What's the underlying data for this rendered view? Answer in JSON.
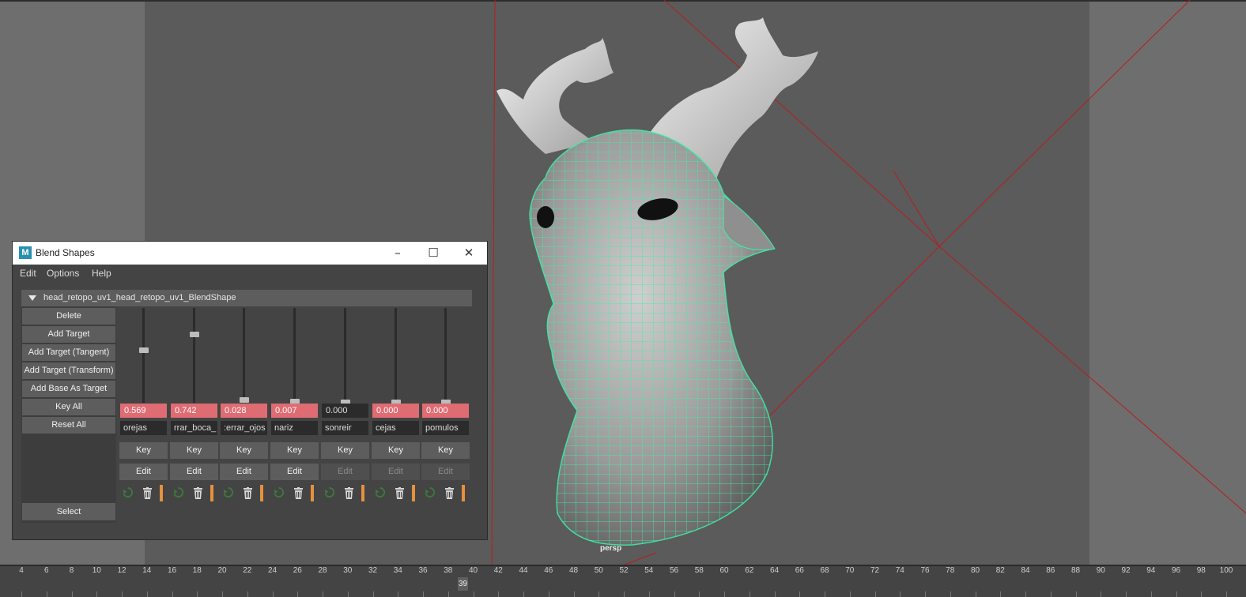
{
  "window": {
    "title": "Blend Shapes",
    "menus": [
      "Edit",
      "Options",
      "Help"
    ],
    "blendshape_node": "head_retopo_uv1_head_retopo_uv1_BlendShape",
    "actions": [
      "Delete",
      "Add Target",
      "Add Target (Tangent)",
      "Add Target (Transform)",
      "Add Base As Target",
      "Key All",
      "Reset All"
    ],
    "select_label": "Select",
    "key_label": "Key",
    "edit_label": "Edit",
    "targets": [
      {
        "name": "orejas",
        "weight": "0.569",
        "level": 0.569,
        "active": true,
        "editable": true
      },
      {
        "name": "rrar_boca_",
        "weight": "0.742",
        "level": 0.742,
        "active": true,
        "editable": true
      },
      {
        "name": ":errar_ojos",
        "weight": "0.028",
        "level": 0.028,
        "active": true,
        "editable": true
      },
      {
        "name": "nariz",
        "weight": "0.007",
        "level": 0.007,
        "active": true,
        "editable": true
      },
      {
        "name": "sonreir",
        "weight": "0.000",
        "level": 0.0,
        "active": false,
        "editable": false
      },
      {
        "name": "cejas",
        "weight": "0.000",
        "level": 0.0,
        "active": true,
        "editable": false
      },
      {
        "name": "pomulos",
        "weight": "0.000",
        "level": 0.0,
        "active": true,
        "editable": false
      }
    ],
    "icons": {
      "minimize": "minimize-icon",
      "maximize": "maximize-icon",
      "close": "close-icon",
      "app": "maya-icon"
    }
  },
  "viewport": {
    "camera_label": "persp"
  },
  "timeline": {
    "ticks": [
      "4",
      "6",
      "8",
      "10",
      "12",
      "14",
      "16",
      "18",
      "20",
      "22",
      "24",
      "26",
      "28",
      "30",
      "32",
      "34",
      "36",
      "38",
      "40",
      "42",
      "44",
      "46",
      "48",
      "50",
      "52",
      "54",
      "56",
      "58",
      "60",
      "62",
      "64",
      "66",
      "68",
      "70",
      "72",
      "74",
      "76",
      "78",
      "80",
      "82",
      "84",
      "86",
      "88",
      "90",
      "92",
      "94",
      "96",
      "98",
      "100"
    ],
    "current_frame": "39"
  },
  "colors": {
    "weight_on": "#e06c73",
    "wireframe": "#3df0a8",
    "key_accent": "#e5913d"
  }
}
